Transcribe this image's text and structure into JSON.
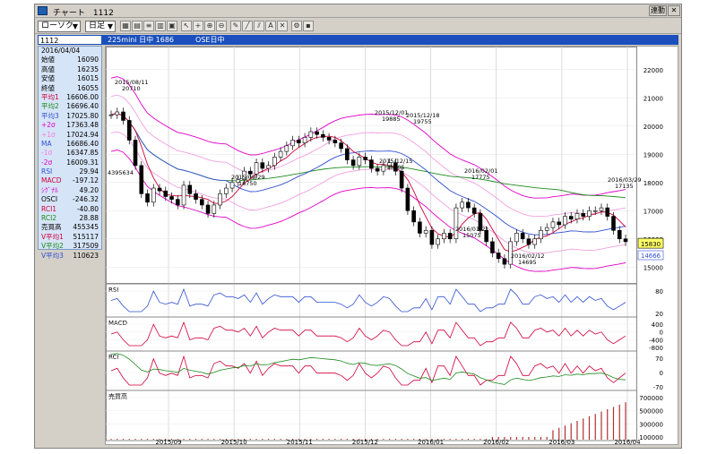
{
  "window": {
    "title": "チャート　1112",
    "btn_restore": "連動",
    "btn_close": "✕"
  },
  "toolbar": {
    "chart_type": "ローソク",
    "period": "日足"
  },
  "infobar": {
    "code": "1112",
    "text": "225mini 日中 1686　　　OSE日中"
  },
  "side_panel": {
    "date": "2016/04/04",
    "rows": [
      {
        "k": "始値",
        "v": "16090",
        "c": "#000000"
      },
      {
        "k": "高値",
        "v": "16235",
        "c": "#000000"
      },
      {
        "k": "安値",
        "v": "16015",
        "c": "#000000"
      },
      {
        "k": "終値",
        "v": "16055",
        "c": "#000000"
      },
      {
        "k": "平均1",
        "v": "16606.00",
        "c": "#d0003a"
      },
      {
        "k": "平均2",
        "v": "16696.40",
        "c": "#1a8a1a"
      },
      {
        "k": "平均3",
        "v": "17025.80",
        "c": "#3050d0"
      },
      {
        "k": "+2σ",
        "v": "17363.48",
        "c": "#e000c8"
      },
      {
        "k": "+1σ",
        "v": "17024.94",
        "c": "#f080d8"
      },
      {
        "k": "MA",
        "v": "16686.40",
        "c": "#3050d0"
      },
      {
        "k": "-1σ",
        "v": "16347.85",
        "c": "#f080d8"
      },
      {
        "k": "-2σ",
        "v": "16009.31",
        "c": "#e000c8"
      },
      {
        "k": "RSI",
        "v": "29.94",
        "c": "#3050d0"
      },
      {
        "k": "MACD",
        "v": "-197.12",
        "c": "#d0003a"
      },
      {
        "k": "ｼｸﾞﾅﾙ",
        "v": "49.20",
        "c": "#e000c8"
      },
      {
        "k": "OSCI",
        "v": "-246.32",
        "c": "#000000"
      },
      {
        "k": "RCI1",
        "v": "-40.80",
        "c": "#d0003a"
      },
      {
        "k": "RCI2",
        "v": "28.88",
        "c": "#1a8a1a"
      },
      {
        "k": "売買高",
        "v": "455345",
        "c": "#000000"
      },
      {
        "k": "V平均1",
        "v": "515117",
        "c": "#d0003a"
      },
      {
        "k": "V平均2",
        "v": "317509",
        "c": "#1a8a1a"
      },
      {
        "k": "V平均3",
        "v": "110623",
        "c": "#3050d0"
      }
    ]
  },
  "chart_data": {
    "type": "candlestick",
    "price_axis": [
      "22000",
      "21000",
      "20000",
      "19000",
      "18000",
      "17000",
      "16000",
      "15000"
    ],
    "price_ylim": [
      14500,
      22500
    ],
    "x_labels": [
      "2015/09",
      "2015/10",
      "2015/11",
      "2015/12",
      "2016/01",
      "2016/02",
      "2016/03",
      "2016/04"
    ],
    "current_price": "15830",
    "lowest_price_label": "14666",
    "left_marker": "4395634",
    "annotations": [
      {
        "date": "2015/08/11",
        "value": "20710"
      },
      {
        "date": "2015/09/29",
        "value": "16750"
      },
      {
        "date": "2015/12/01",
        "value": "19885"
      },
      {
        "date": "2015/12/18",
        "value": "19755"
      },
      {
        "date": "2015/12/15",
        "value": "18405"
      },
      {
        "date": "2016/02/01",
        "value": "17775"
      },
      {
        "date": "2016/01/21",
        "value": "15075"
      },
      {
        "date": "2016/02/12",
        "value": "14695"
      },
      {
        "date": "2016/03/29",
        "value": "17135"
      }
    ],
    "close_series": [
      20400,
      20500,
      20200,
      19500,
      18600,
      17600,
      17300,
      17800,
      17700,
      17500,
      17400,
      17200,
      17900,
      17600,
      17400,
      17200,
      16900,
      17200,
      17600,
      17800,
      18000,
      18100,
      18400,
      18300,
      18700,
      18500,
      18600,
      18900,
      19100,
      19300,
      19500,
      19400,
      19600,
      19800,
      19700,
      19600,
      19500,
      19400,
      19200,
      18800,
      18600,
      18900,
      18800,
      18500,
      18400,
      18600,
      18700,
      18400,
      17800,
      17000,
      16600,
      16200,
      16300,
      15800,
      16000,
      16200,
      16000,
      17100,
      17300,
      17100,
      16900,
      16300,
      15900,
      15500,
      15300,
      15100,
      15900,
      16200,
      16000,
      15800,
      16000,
      16300,
      16400,
      16600,
      16500,
      16800,
      16700,
      16900,
      16800,
      17000,
      17000,
      17100,
      16800,
      16300,
      16000,
      15900
    ],
    "rsi_axis": [
      "80",
      "20"
    ],
    "macd_axis": [
      "400",
      "0",
      "-400",
      "-800"
    ],
    "rci_axis": [
      "70",
      "0",
      "-70"
    ],
    "volume_axis": [
      "700000",
      "500000",
      "300000",
      "100000"
    ],
    "panel_labels": {
      "rsi": "RSI",
      "macd": "MACD",
      "rci": "RCI",
      "volume": "売買高"
    }
  }
}
